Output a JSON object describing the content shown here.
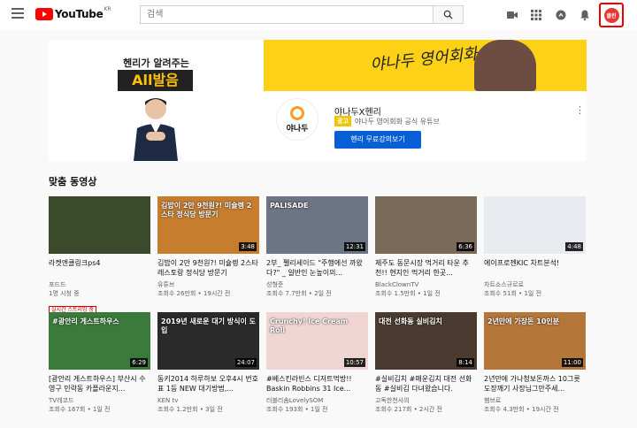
{
  "header": {
    "logo_text": "YouTube",
    "logo_region": "KR",
    "search_placeholder": "검색",
    "avatar_text": "클린"
  },
  "banner": {
    "ad_top_text": "헨리가 알려주는",
    "ad_big_text": "All발음",
    "yellow_script": "야나두 영어회화",
    "channel_logo_text": "야나두",
    "channel_name": "야나두X헨리",
    "ad_badge": "광고",
    "channel_desc": "야나두 영어회화 공식 유튜브",
    "cta_label": "헨리 무료강의보기"
  },
  "section": {
    "title": "맞춤 동영상"
  },
  "videos": [
    {
      "title": "라켓엔클링크ps4",
      "channel": "포드드",
      "meta": "1명 시청 중",
      "live_badge": "실시간 스트리밍 중",
      "duration": "",
      "thumb_text": "",
      "thumb_color": "#3b4a2a"
    },
    {
      "title": "김밥이 2만 9천원?! 미슐렝 2스타 레스토랑 정식당 방문기",
      "channel": "유튜브",
      "meta": "조회수 26만회 • 19시간 전",
      "live_badge": "",
      "duration": "3:48",
      "thumb_text": "김밥이 2만 9천원?! 미슐렝 2스타 정식당 방문기",
      "thumb_color": "#c77d2e"
    },
    {
      "title": "2부_ 펠리세이드 \"주행에선 까왔다?\" _ 일반인 눈높이의...",
      "channel": "성형준",
      "meta": "조회수 7.7만회 • 2일 전",
      "live_badge": "",
      "duration": "12:31",
      "thumb_text": "PALISADE",
      "thumb_color": "#6b7583"
    },
    {
      "title": "제주도 동문시장 먹거리 타운 추천!! 현지인 먹거리 한곳...",
      "channel": "BlackClownTV",
      "meta": "조회수 1.5만회 • 1일 전",
      "live_badge": "",
      "duration": "6:36",
      "thumb_text": "",
      "thumb_color": "#7a6a58"
    },
    {
      "title": "에이프로젠KIC 차트분석!",
      "channel": "차트소스규르로",
      "meta": "조회수 51회 • 1일 전",
      "live_badge": "",
      "duration": "4:48",
      "thumb_text": "",
      "thumb_color": "#e8ecf0"
    },
    {
      "title": "[광안리 게스트하우스] 부산시 수영구 민락동 카플라운지...",
      "channel": "TV레코드",
      "meta": "조회수 167회 • 1일 전",
      "live_badge": "",
      "duration": "6:29",
      "thumb_text": "#광안리 게스트하우스",
      "thumb_color": "#3a7a3a"
    },
    {
      "title": "동키2014 하루하보 오후4시 번호표 1등 NEW 대기방법,...",
      "channel": "KEN tv",
      "meta": "조회수 1.2만회 • 3일 전",
      "live_badge": "",
      "duration": "24:07",
      "thumb_text": "2019년 새로운 대기 방식이 도입",
      "thumb_color": "#2a2a2a"
    },
    {
      "title": "#베스킨라빈스 디저트먹방!! Baskin Robbins 31 Ice...",
      "channel": "러블리솜LovelySOM",
      "meta": "조회수 193회 • 1일 전",
      "live_badge": "",
      "duration": "10:57",
      "thumb_text": "Crunchy! Ice Cream Roll",
      "thumb_color": "#f0d6d2"
    },
    {
      "title": "#실비김치 #매운김치 대전 선화동 #실비김 다녀왔습니다.",
      "channel": "고독한천사의",
      "meta": "조회수 217회 • 2시간 전",
      "live_badge": "",
      "duration": "8:14",
      "thumb_text": "대전 선화동 실비김치",
      "thumb_color": "#4a3a30"
    },
    {
      "title": "2년만에 가나청보돈까스 10그릇 도장깨기 사장님그만주세...",
      "channel": "햄브로",
      "meta": "조회수 4.3만회 • 19시간 전",
      "live_badge": "",
      "duration": "11:00",
      "thumb_text": "2년만에 가장돈 10인분",
      "thumb_color": "#b5763a"
    }
  ]
}
